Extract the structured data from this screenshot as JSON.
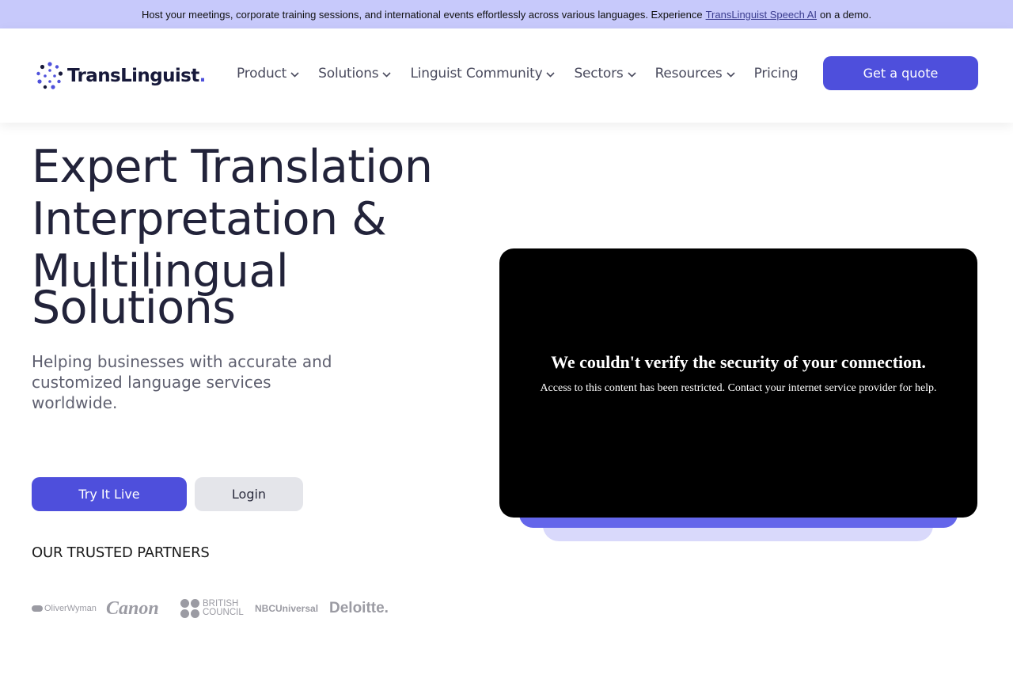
{
  "announcement": {
    "text_before": "Host your meetings, corporate training sessions, and international events effortlessly across various languages. Experience",
    "link_text": "TransLinguist Speech AI",
    "text_after": "on a demo."
  },
  "header": {
    "logo_text": "TransLinguist",
    "logo_dot": ".",
    "nav": [
      {
        "label": "Product",
        "icon": "chevron-down-icon"
      },
      {
        "label": "Solutions",
        "icon": "chevron-down-icon"
      },
      {
        "label": "Linguist Community",
        "icon": "chevron-down-icon"
      },
      {
        "label": "Sectors",
        "icon": "chevron-down-icon"
      },
      {
        "label": "Resources",
        "icon": "chevron-down-icon"
      },
      {
        "label": "Pricing"
      }
    ],
    "cta_label": "Get a quote"
  },
  "hero": {
    "title_lines": [
      "Expert Translation",
      "Interpretation &",
      "Multilingual",
      "Solutions"
    ],
    "subtitle": "Helping businesses with accurate and customized language services worldwide.",
    "primary_button": "Try It Live",
    "secondary_button": "Login"
  },
  "partners": {
    "heading": "OUR TRUSTED PARTNERS",
    "logos": [
      "OliverWyman",
      "Canon",
      "BRITISH COUNCIL",
      "NBCUniversal",
      "Deloitte."
    ]
  },
  "video": {
    "title": "We couldn't verify the security of your connection.",
    "message": "Access to this content has been restricted. Contact your internet service provider for help."
  },
  "colors": {
    "accent": "#4e4fdc",
    "announcement_bg": "#c7c9fb",
    "partner_gray": "#9b9ba3"
  }
}
